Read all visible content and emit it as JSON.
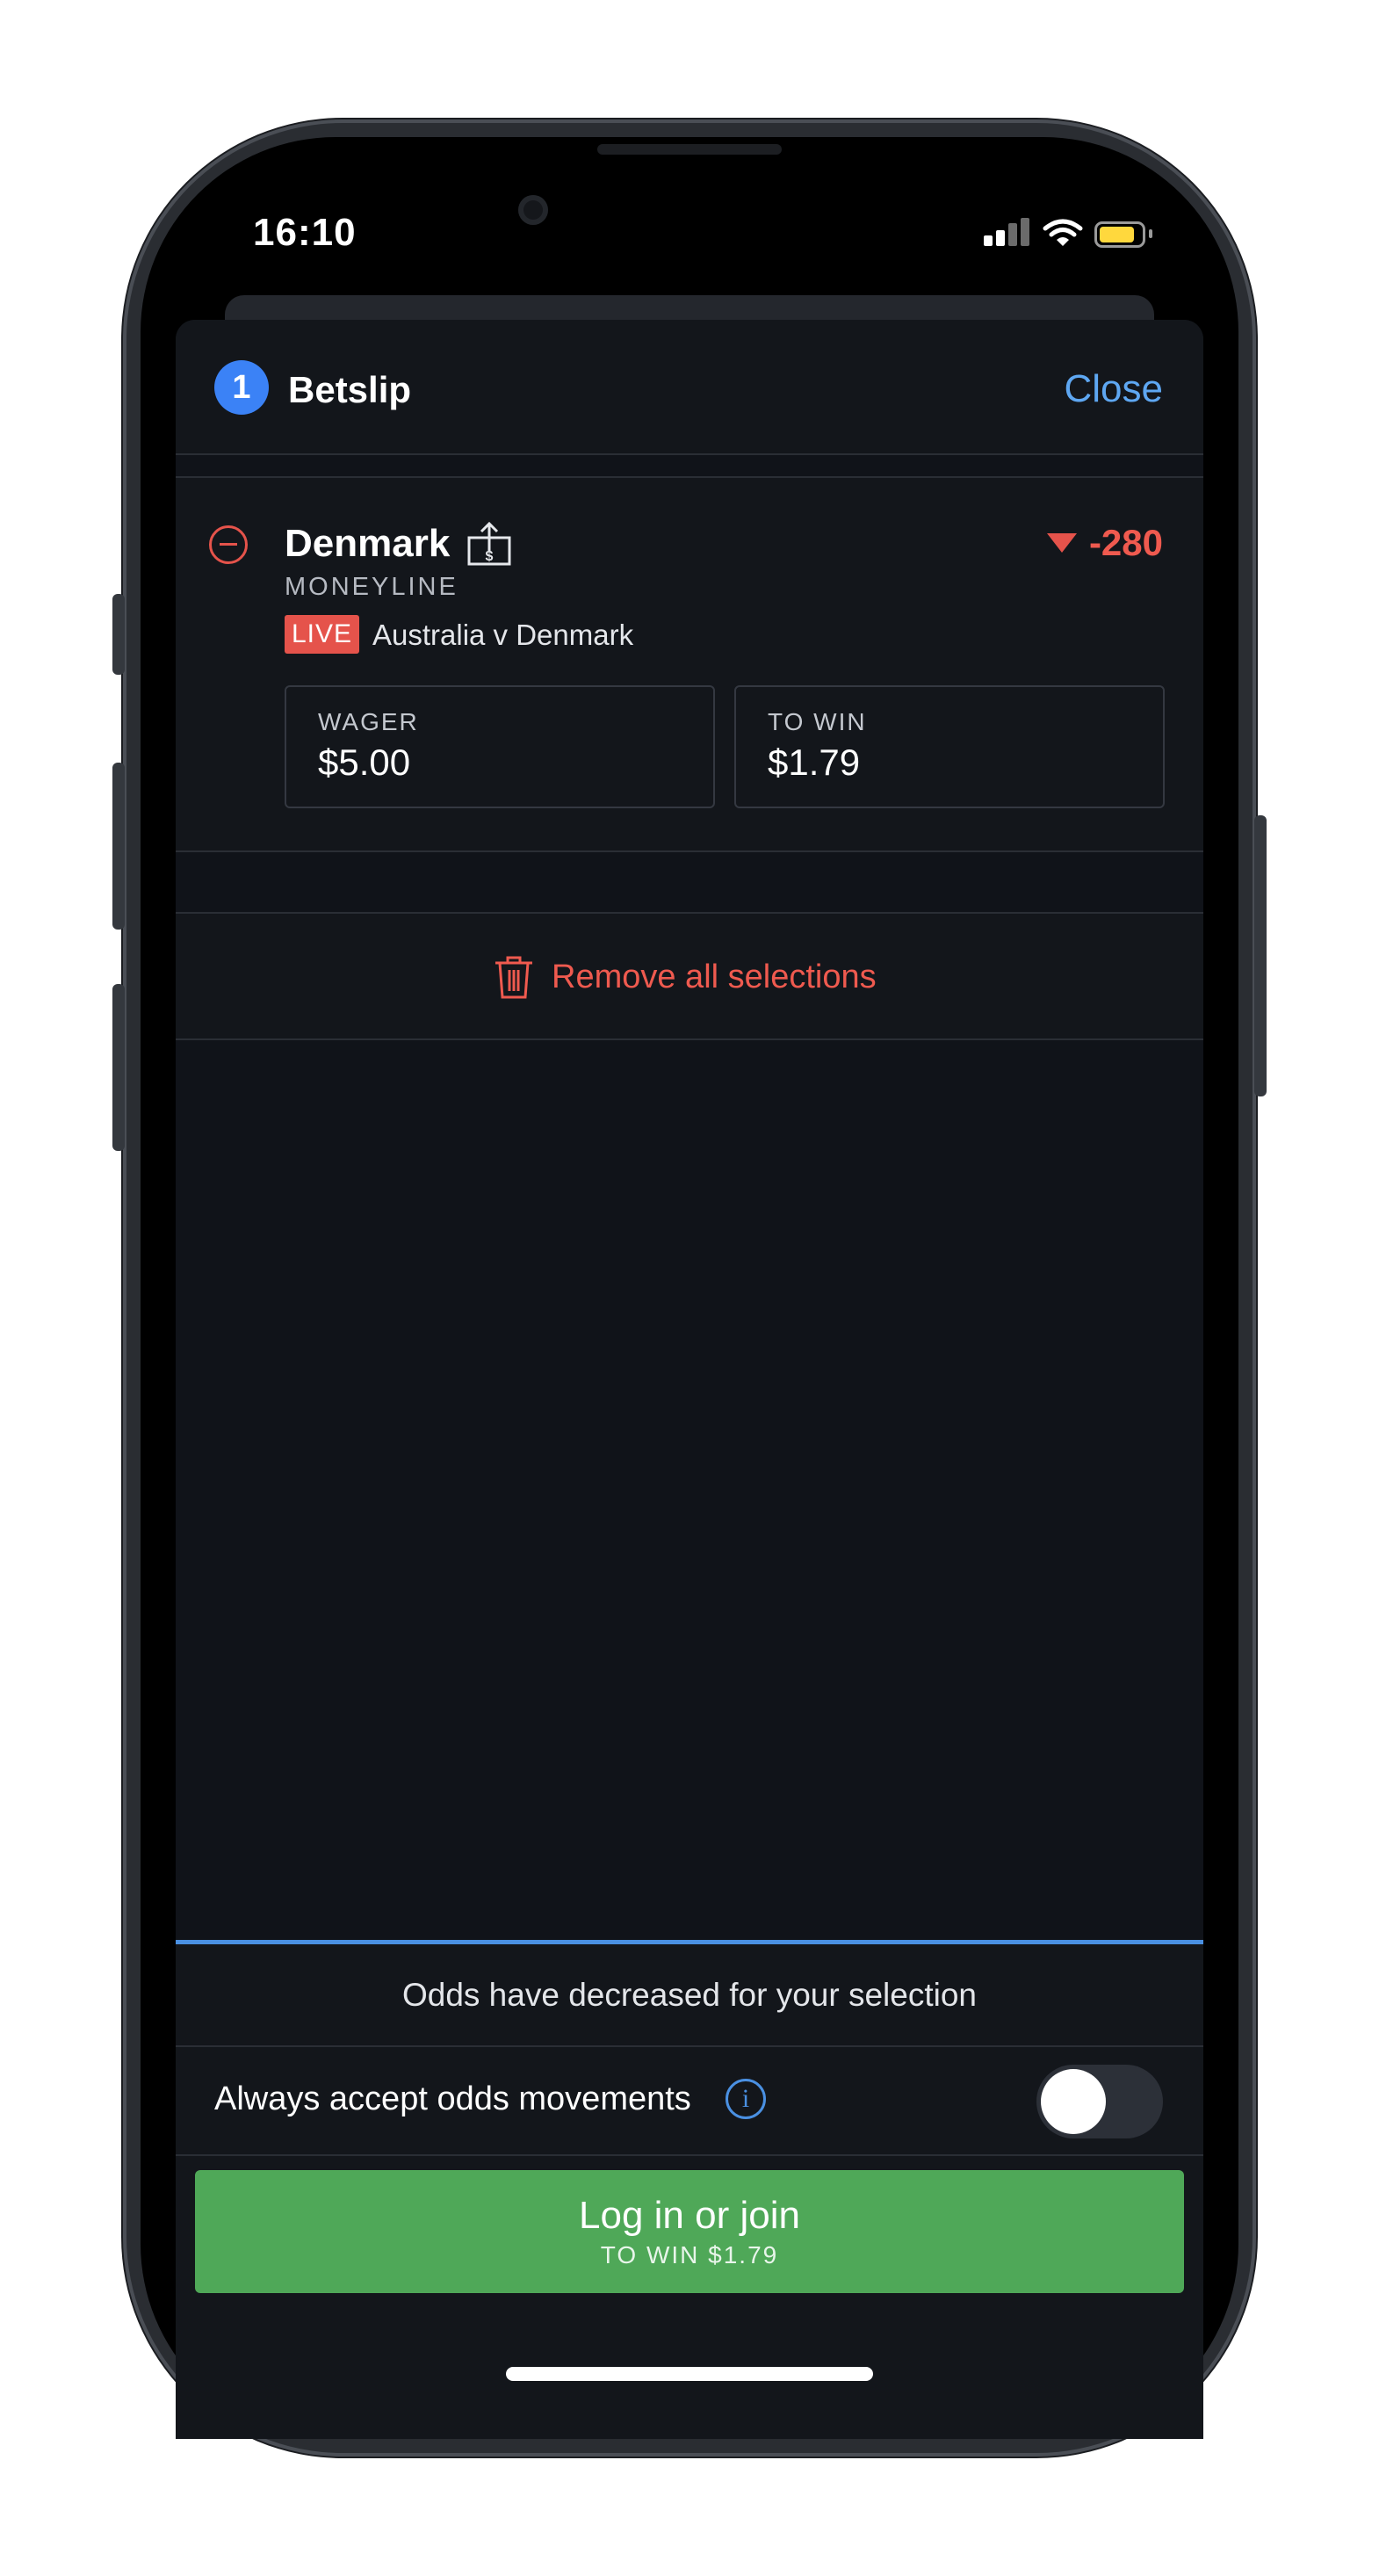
{
  "status_bar": {
    "time": "16:10"
  },
  "betslip": {
    "count": "1",
    "title": "Betslip",
    "close_label": "Close"
  },
  "selection": {
    "team": "Denmark",
    "market": "MONEYLINE",
    "odds": "-280",
    "odds_trend": "decreased",
    "live_label": "LIVE",
    "event": "Australia v Denmark",
    "wager_label": "WAGER",
    "wager_value": "$5.00",
    "to_win_label": "TO WIN",
    "to_win_value": "$1.79"
  },
  "actions": {
    "remove_all_label": "Remove all selections"
  },
  "footer": {
    "notice": "Odds have decreased for your selection",
    "accept_label": "Always accept odds movements",
    "accept_enabled": false,
    "cta_main": "Log in or join",
    "cta_sub": "TO WIN $1.79"
  },
  "icons": {
    "remove": "minus-circle-icon",
    "share": "share-bet-icon",
    "odds_down": "triangle-down-icon",
    "trash": "trash-icon",
    "info": "info-icon"
  },
  "colors": {
    "accent_blue": "#3b82f6",
    "link_blue": "#5ea7f2",
    "alert_red": "#ef5a4f",
    "live_red": "#e5534b",
    "cta_green": "#4fa858",
    "sheet_bg": "#101319"
  }
}
